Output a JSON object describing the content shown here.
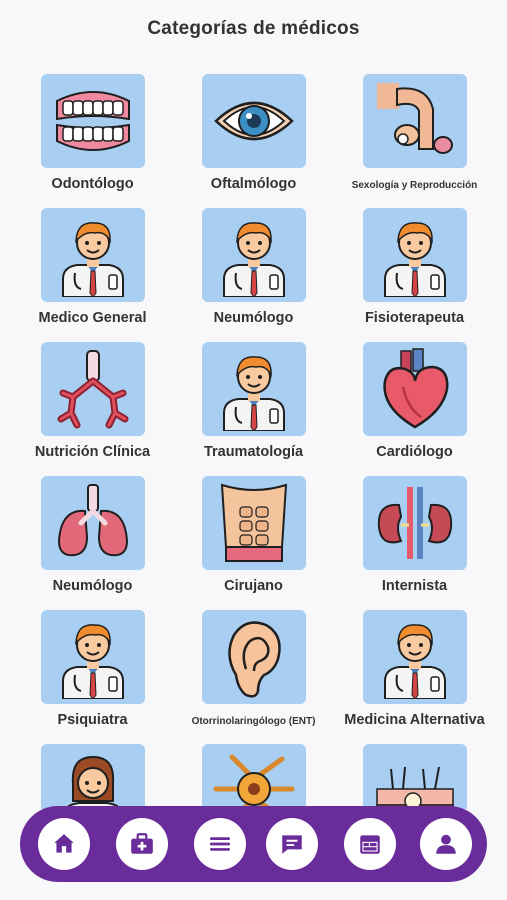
{
  "header": {
    "title": "Categorías de médicos"
  },
  "categories": [
    {
      "label": "Odontólogo",
      "icon": "teeth-icon"
    },
    {
      "label": "Oftalmólogo",
      "icon": "eye-icon"
    },
    {
      "label": "Sexología y Reproducción",
      "icon": "reproductive-icon"
    },
    {
      "label": "Medico General",
      "icon": "doctor-icon"
    },
    {
      "label": "Neumólogo",
      "icon": "doctor-icon"
    },
    {
      "label": "Fisioterapeuta",
      "icon": "doctor-icon"
    },
    {
      "label": "Nutrición Clínica",
      "icon": "bronchi-icon"
    },
    {
      "label": "Traumatología",
      "icon": "doctor-icon"
    },
    {
      "label": "Cardiólogo",
      "icon": "heart-icon"
    },
    {
      "label": "Neumólogo",
      "icon": "lungs-icon"
    },
    {
      "label": "Cirujano",
      "icon": "abdomen-icon"
    },
    {
      "label": "Internista",
      "icon": "kidneys-icon"
    },
    {
      "label": "Psiquiatra",
      "icon": "doctor-icon"
    },
    {
      "label": "Otorrinolaringólogo (ENT)",
      "icon": "ear-icon"
    },
    {
      "label": "Medicina Alternativa",
      "icon": "doctor-icon"
    },
    {
      "label": "",
      "icon": "female-doctor-icon"
    },
    {
      "label": "",
      "icon": "neuron-icon"
    },
    {
      "label": "",
      "icon": "skin-icon"
    }
  ],
  "nav": {
    "items": [
      {
        "icon": "home-icon"
      },
      {
        "icon": "medical-kit-icon"
      },
      {
        "icon": "menu-icon"
      },
      {
        "icon": "chat-icon"
      },
      {
        "icon": "calendar-icon"
      },
      {
        "icon": "profile-icon"
      }
    ]
  },
  "colors": {
    "tile": "#a8cff2",
    "navbar": "#6a2c9a",
    "text": "#333333",
    "background": "#f8f8fa"
  }
}
